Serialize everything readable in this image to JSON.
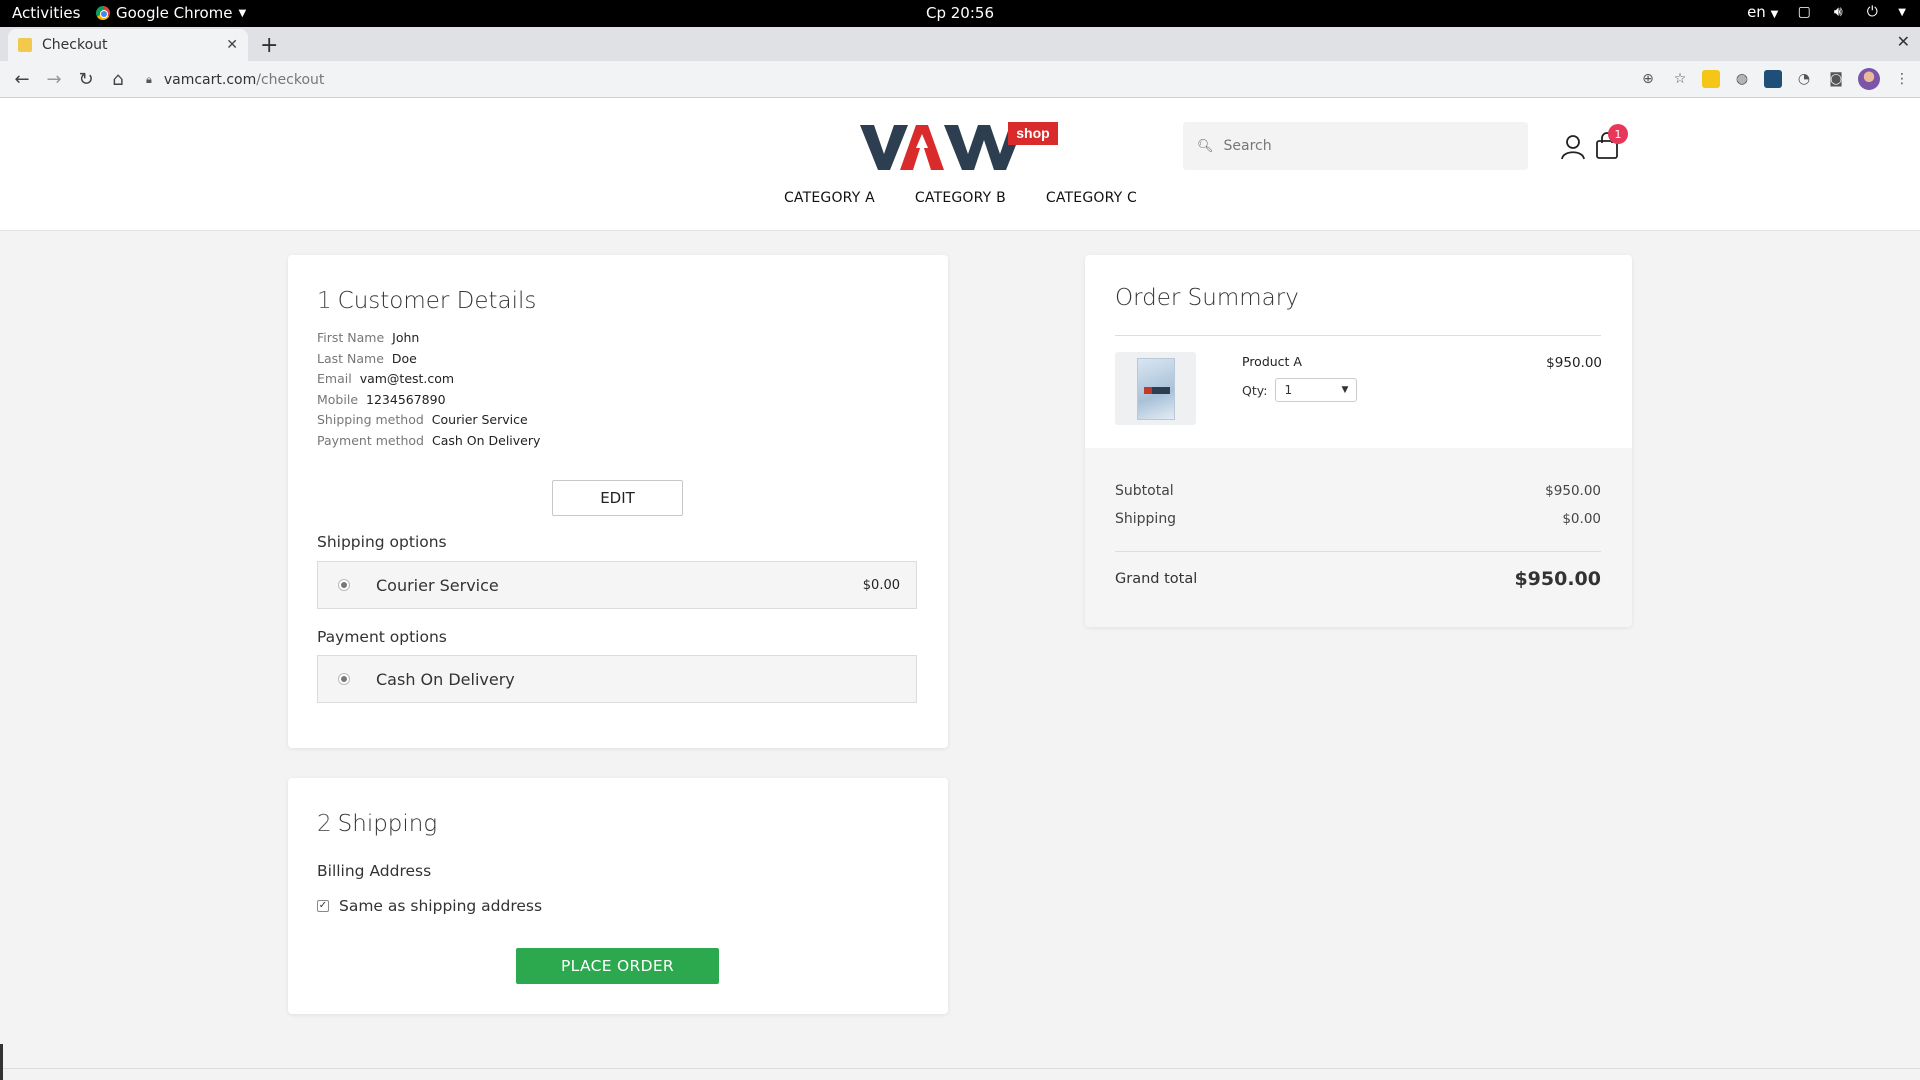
{
  "os_bar": {
    "activities": "Activities",
    "app_name": "Google Chrome",
    "clock": "Ср 20:56",
    "language": "en"
  },
  "browser": {
    "tab_title": "Checkout",
    "url_host": "vamcart.com",
    "url_path": "/checkout"
  },
  "site": {
    "logo_text": "VAM",
    "logo_badge": "shop",
    "search_placeholder": "Search",
    "cart_count": "1",
    "categories": [
      "CATEGORY A",
      "CATEGORY B",
      "CATEGORY C"
    ]
  },
  "customer": {
    "step_num": "1",
    "title": "Customer Details",
    "fields": [
      {
        "label": "First Name",
        "value": "John"
      },
      {
        "label": "Last Name",
        "value": "Doe"
      },
      {
        "label": "Email",
        "value": "vam@test.com"
      },
      {
        "label": "Mobile",
        "value": "1234567890"
      },
      {
        "label": "Shipping method",
        "value": "Courier Service"
      },
      {
        "label": "Payment method",
        "value": "Cash On Delivery"
      }
    ],
    "edit_label": "EDIT",
    "shipping_options_label": "Shipping options",
    "shipping_option": {
      "name": "Courier Service",
      "price": "$0.00"
    },
    "payment_options_label": "Payment options",
    "payment_option": {
      "name": "Cash On Delivery"
    }
  },
  "shipping": {
    "step_num": "2",
    "title": "Shipping",
    "billing_label": "Billing Address",
    "same_as_label": "Same as shipping address",
    "place_order_label": "PLACE ORDER"
  },
  "summary": {
    "title": "Order Summary",
    "product_name": "Product A",
    "qty_label": "Qty:",
    "qty_value": "1",
    "product_price": "$950.00",
    "subtotal_label": "Subtotal",
    "subtotal": "$950.00",
    "shipping_label": "Shipping",
    "shipping": "$0.00",
    "grand_total_label": "Grand total",
    "grand_total": "$950.00"
  },
  "colors": {
    "accent_green": "#2ca84e",
    "badge_red": "#e8385a",
    "logo_navy": "#2c3e50",
    "logo_red": "#d92b2b"
  }
}
